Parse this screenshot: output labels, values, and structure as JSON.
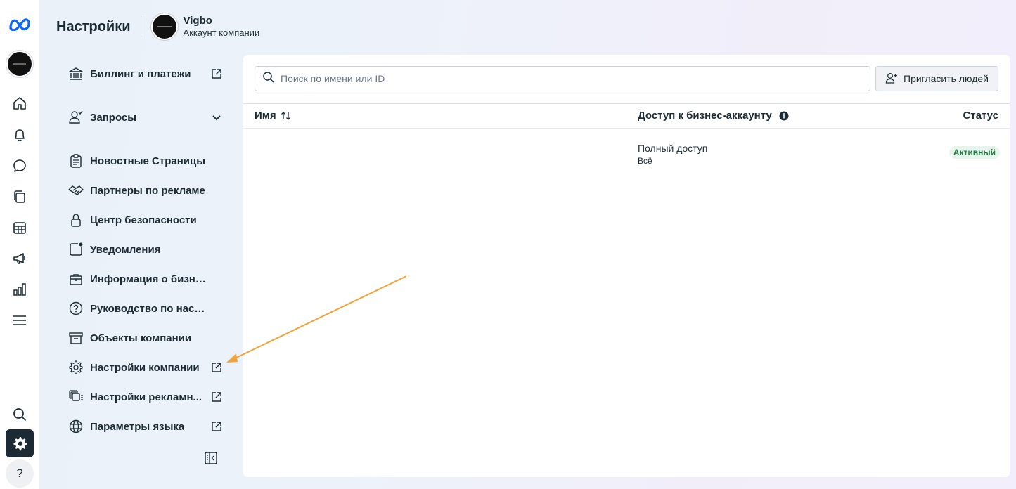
{
  "header": {
    "title": "Настройки",
    "account_name": "Vigbo",
    "account_type": "Аккаунт компании"
  },
  "rail": {
    "items": [
      "meta-logo-icon",
      "account-avatar",
      "home-icon",
      "bell-icon",
      "chat-icon",
      "pages-icon",
      "table-icon",
      "megaphone-icon",
      "analytics-icon",
      "menu-icon",
      "search-icon",
      "settings-icon",
      "help-icon"
    ],
    "active": "settings-icon",
    "help_label": "?"
  },
  "nav": {
    "items": [
      {
        "label": "Биллинг и платежи",
        "icon": "bank-icon",
        "right": "external-link-icon"
      },
      {
        "label": "Запросы",
        "icon": "person-request-icon",
        "right": "chevron-down-icon"
      },
      {
        "label": "Новостные Страницы",
        "icon": "clipboard-icon"
      },
      {
        "label": "Партнеры по рекламе",
        "icon": "handshake-icon"
      },
      {
        "label": "Центр безопасности",
        "icon": "lock-icon"
      },
      {
        "label": "Уведомления",
        "icon": "notification-icon"
      },
      {
        "label": "Информация о бизне...",
        "icon": "briefcase-icon"
      },
      {
        "label": "Руководство по настр...",
        "icon": "question-icon"
      },
      {
        "label": "Объекты компании",
        "icon": "archive-icon"
      },
      {
        "label": "Настройки компании",
        "icon": "gear-icon",
        "right": "external-link-icon"
      },
      {
        "label": "Настройки рекламн...",
        "icon": "ad-settings-icon",
        "right": "external-link-icon"
      },
      {
        "label": "Параметры языка",
        "icon": "globe-icon",
        "right": "external-link-icon"
      }
    ]
  },
  "main": {
    "search_placeholder": "Поиск по имени или ID",
    "invite_label": "Пригласить людей",
    "columns": {
      "name": "Имя",
      "access": "Доступ к бизнес-аккаунту",
      "status": "Статус"
    },
    "rows": [
      {
        "name": "",
        "access": "Полный доступ",
        "access_sub": "Всё",
        "status": "Активный"
      }
    ]
  },
  "colors": {
    "accent": "#0866ff",
    "dark": "#1c2b33",
    "status_active_bg": "#e7f5ec",
    "status_active_text": "#1d7a3f",
    "annotation_arrow": "#f2a33a"
  }
}
